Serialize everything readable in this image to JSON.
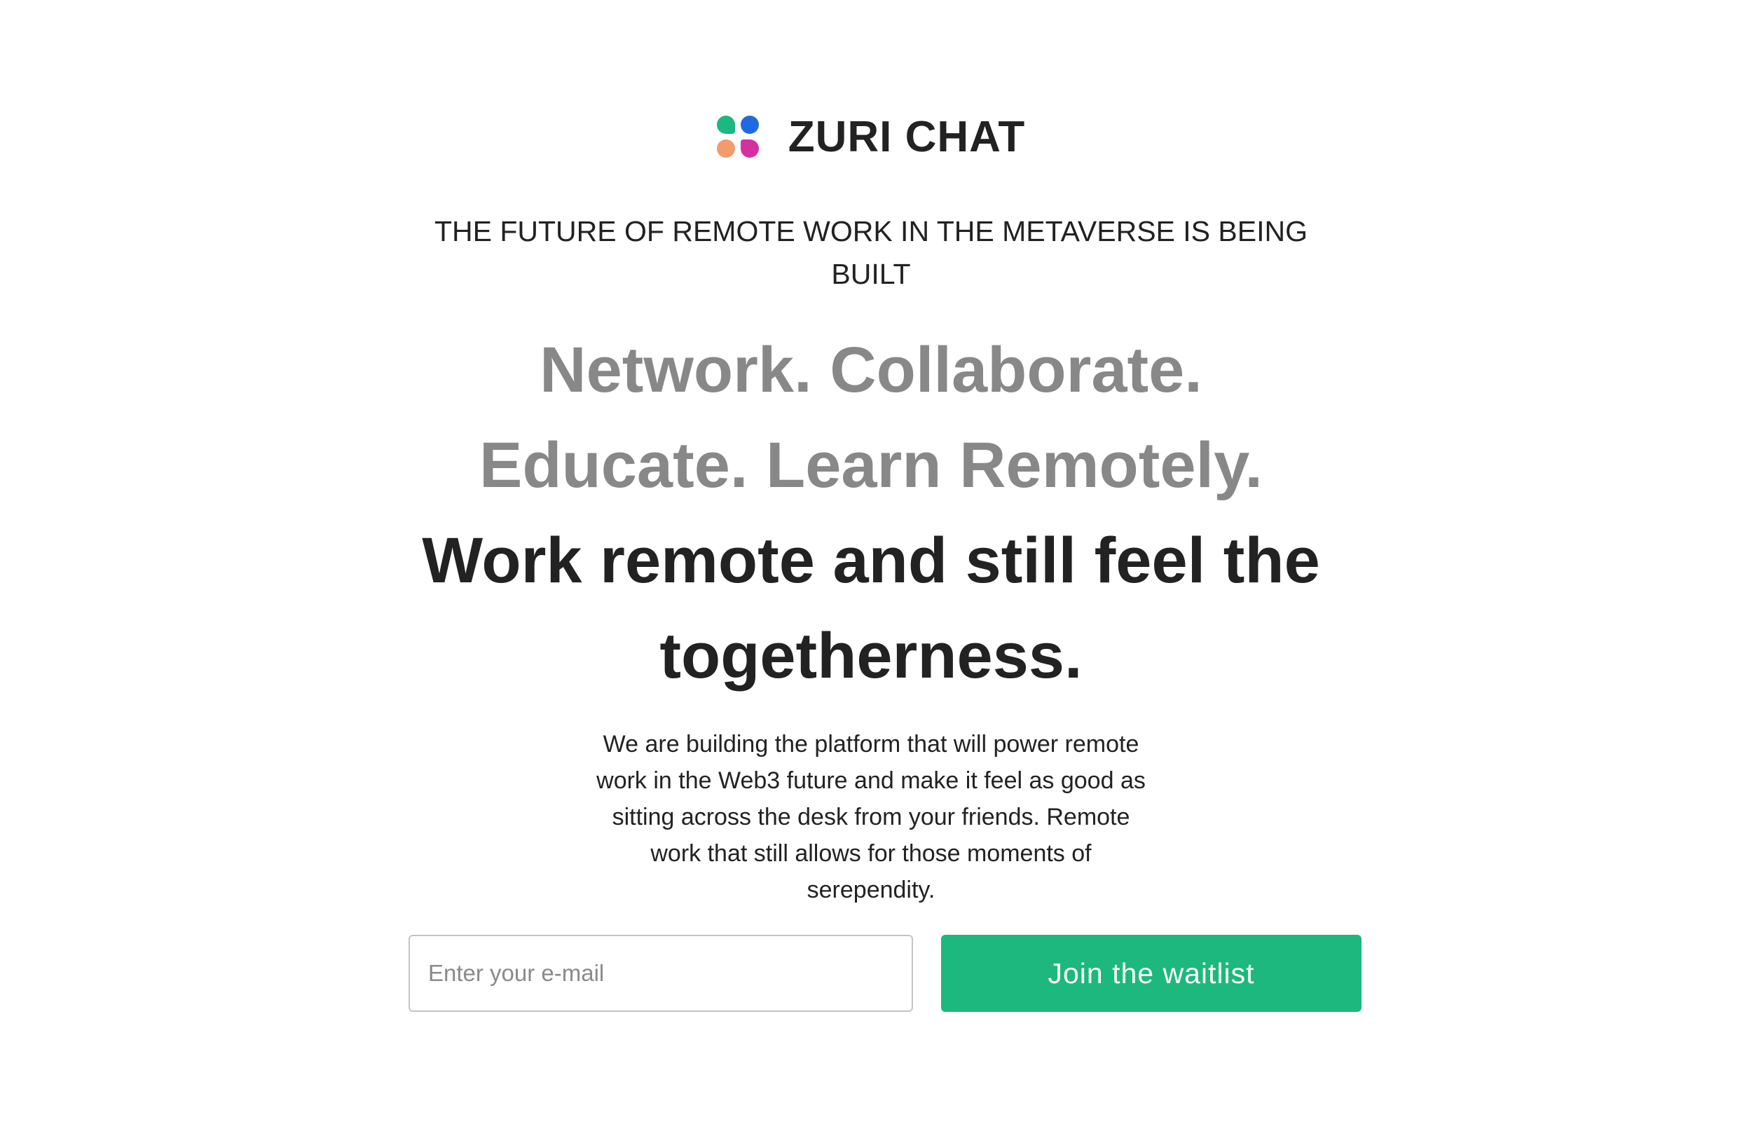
{
  "brand": {
    "name": "ZURI CHAT",
    "logo_icon": "zuri-four-dot-logo-icon",
    "logo_colors": [
      "#1cb881",
      "#1f6ae0",
      "#f29b6b",
      "#d62fa1"
    ]
  },
  "tagline": "THE FUTURE OF REMOTE WORK IN THE METAVERSE IS BEING BUILT",
  "hero": {
    "line1": "Network. Collaborate.",
    "line2": "Educate. Learn Remotely.",
    "line3": "Work remote and still feel the togetherness."
  },
  "description": "We are building the platform that will power remote work in the Web3 future and make it feel as good as sitting across the desk from your friends. Remote work that still allows for those moments of serependity.",
  "waitlist_form": {
    "email_placeholder": "Enter your e-mail",
    "email_value": "",
    "button_label": "Join the waitlist",
    "button_color": "#1cb87d"
  }
}
